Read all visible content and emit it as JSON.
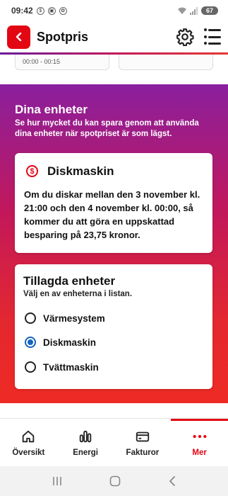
{
  "status_bar": {
    "time": "09:42",
    "battery": "67"
  },
  "header": {
    "title": "Spotpris"
  },
  "prev_cards": {
    "left_text": "00:00 - 00:15"
  },
  "section": {
    "title": "Dina enheter",
    "subtitle": "Se hur mycket du kan spara genom att använda dina enheter när spotpriset är som lägst."
  },
  "savings_card": {
    "title": "Diskmaskin",
    "text": "Om du diskar mellan den 3 november kl. 21:00 och den 4 november kl. 00:00, så kommer du att göra en uppskattad besparing på 23,75 kronor."
  },
  "devices_card": {
    "title": "Tillagda enheter",
    "subtitle": "Välj en av enheterna i listan.",
    "options": [
      {
        "label": "Värmesystem",
        "selected": false
      },
      {
        "label": "Diskmaskin",
        "selected": true
      },
      {
        "label": "Tvättmaskin",
        "selected": false
      }
    ]
  },
  "bottom_nav": {
    "items": [
      {
        "label": "Översikt",
        "icon": "home-icon"
      },
      {
        "label": "Energi",
        "icon": "bar-chart-icon"
      },
      {
        "label": "Fakturor",
        "icon": "card-icon"
      },
      {
        "label": "Mer",
        "icon": "more-dots-icon",
        "active": true
      }
    ]
  },
  "colors": {
    "accent": "#e30613",
    "radio_selected": "#1565c0",
    "gradient_top": "#8a1f9e",
    "gradient_bottom": "#ee2a24"
  }
}
